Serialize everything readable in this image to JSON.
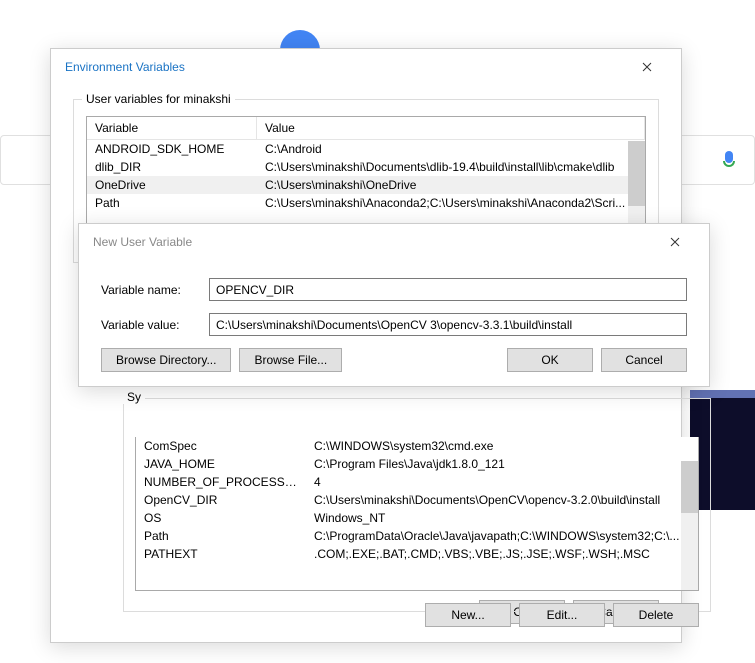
{
  "envDialog": {
    "title": "Environment Variables",
    "userGroupLabel": "User variables for minakshi",
    "sysGroupLabel": "Sy",
    "colVariable": "Variable",
    "colValue": "Value",
    "userVars": [
      {
        "name": "ANDROID_SDK_HOME",
        "value": "C:\\Android"
      },
      {
        "name": "dlib_DIR",
        "value": "C:\\Users\\minakshi\\Documents\\dlib-19.4\\build\\install\\lib\\cmake\\dlib"
      },
      {
        "name": "OneDrive",
        "value": "C:\\Users\\minakshi\\OneDrive"
      },
      {
        "name": "Path",
        "value": "C:\\Users\\minakshi\\Anaconda2;C:\\Users\\minakshi\\Anaconda2\\Scri..."
      }
    ],
    "userSelectedIndex": 2,
    "sysVars": [
      {
        "name": "ComSpec",
        "value": "C:\\WINDOWS\\system32\\cmd.exe"
      },
      {
        "name": "JAVA_HOME",
        "value": "C:\\Program Files\\Java\\jdk1.8.0_121"
      },
      {
        "name": "NUMBER_OF_PROCESSORS",
        "value": "4"
      },
      {
        "name": "OpenCV_DIR",
        "value": "C:\\Users\\minakshi\\Documents\\OpenCV\\opencv-3.2.0\\build\\install"
      },
      {
        "name": "OS",
        "value": "Windows_NT"
      },
      {
        "name": "Path",
        "value": "C:\\ProgramData\\Oracle\\Java\\javapath;C:\\WINDOWS\\system32;C:\\..."
      },
      {
        "name": "PATHEXT",
        "value": ".COM;.EXE;.BAT;.CMD;.VBS;.VBE;.JS;.JSE;.WSF;.WSH;.MSC"
      }
    ],
    "buttons": {
      "new": "New...",
      "edit": "Edit...",
      "delete": "Delete",
      "ok": "OK",
      "cancel": "Cancel"
    }
  },
  "newVarDialog": {
    "title": "New User Variable",
    "nameLabel": "Variable name:",
    "nameValue": "OPENCV_DIR",
    "valueLabel": "Variable value:",
    "valueValue": "C:\\Users\\minakshi\\Documents\\OpenCV 3\\opencv-3.3.1\\build\\install",
    "buttons": {
      "browseDir": "Browse Directory...",
      "browseFile": "Browse File...",
      "ok": "OK",
      "cancel": "Cancel"
    }
  }
}
